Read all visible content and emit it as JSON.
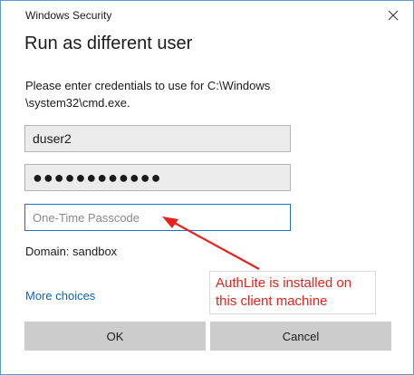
{
  "window": {
    "title": "Windows Security",
    "close_icon": "close-icon"
  },
  "dialog": {
    "heading": "Run as different user",
    "message_line1": "Please enter credentials to use for C:\\Windows",
    "message_line2": "\\system32\\cmd.exe."
  },
  "fields": {
    "username_value": "duser2",
    "password_value": "●●●●●●●●●●●●",
    "otp_placeholder": "One-Time Passcode",
    "otp_value": ""
  },
  "domain": {
    "label": "Domain: sandbox"
  },
  "links": {
    "more_choices": "More choices"
  },
  "buttons": {
    "ok": "OK",
    "cancel": "Cancel"
  },
  "annotation": {
    "line1": "AuthLite is installed on",
    "line2": "this client machine",
    "color": "#e8211b"
  },
  "colors": {
    "accent": "#0b63c9",
    "focus_border": "#1f6fc8",
    "button_bg": "#cccccc",
    "field_bg": "#ebebeb"
  }
}
